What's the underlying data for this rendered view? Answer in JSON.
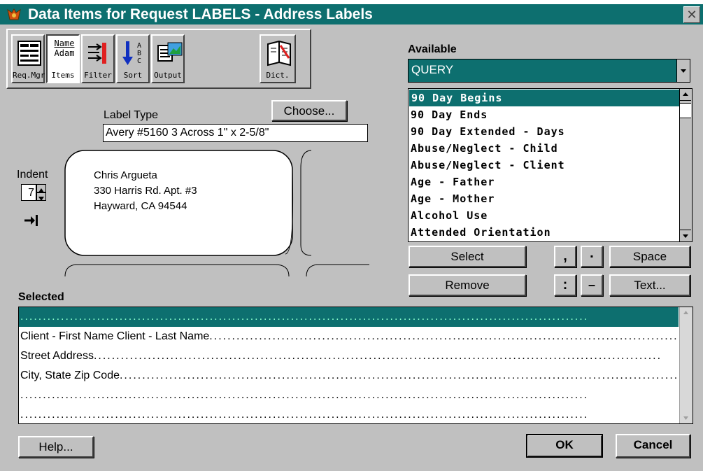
{
  "window": {
    "title": "Data Items for Request LABELS - Address Labels",
    "close_glyph": "✕",
    "accent_color": "#0d6f6f"
  },
  "toolbar": {
    "buttons": [
      {
        "label": "Req.Mgr",
        "icon": "form-icon"
      },
      {
        "label": "Items",
        "icon": "name-items-icon",
        "text1": "Name",
        "text2": "Adam"
      },
      {
        "label": "Filter",
        "icon": "filter-icon"
      },
      {
        "label": "Sort",
        "icon": "sort-icon",
        "letters": "A B C"
      },
      {
        "label": "Output",
        "icon": "output-icon"
      },
      {
        "label": "Dict.",
        "icon": "dictionary-icon"
      }
    ]
  },
  "label_type": {
    "caption": "Label Type",
    "value": "Avery #5160 3 Across  1\" x 2-5/8\"",
    "choose_button": "Choose..."
  },
  "indent": {
    "caption": "Indent",
    "value": "7"
  },
  "label_preview": {
    "lines": [
      "Chris Argueta",
      "330 Harris Rd. Apt. #3",
      "Hayward, CA  94544"
    ]
  },
  "available": {
    "caption": "Available",
    "dropdown_value": "QUERY",
    "items": [
      "90 Day Begins",
      "90 Day Ends",
      "90 Day Extended - Days",
      "Abuse/Neglect - Child",
      "Abuse/Neglect - Client",
      "Age - Father",
      "Age - Mother",
      "Alcohol Use",
      "Attended Orientation"
    ]
  },
  "actions": {
    "select": "Select",
    "remove": "Remove",
    "comma": ",",
    "period": "▪",
    "colon": ":",
    "dash": "–",
    "space": "Space",
    "text": "Text..."
  },
  "selected": {
    "caption": "Selected",
    "rows": [
      "",
      "Client - First Name Client - Last Name",
      "Street Address",
      "City, State  Zip Code",
      "",
      ""
    ]
  },
  "footer": {
    "help": "Help...",
    "ok": "OK",
    "cancel": "Cancel"
  }
}
